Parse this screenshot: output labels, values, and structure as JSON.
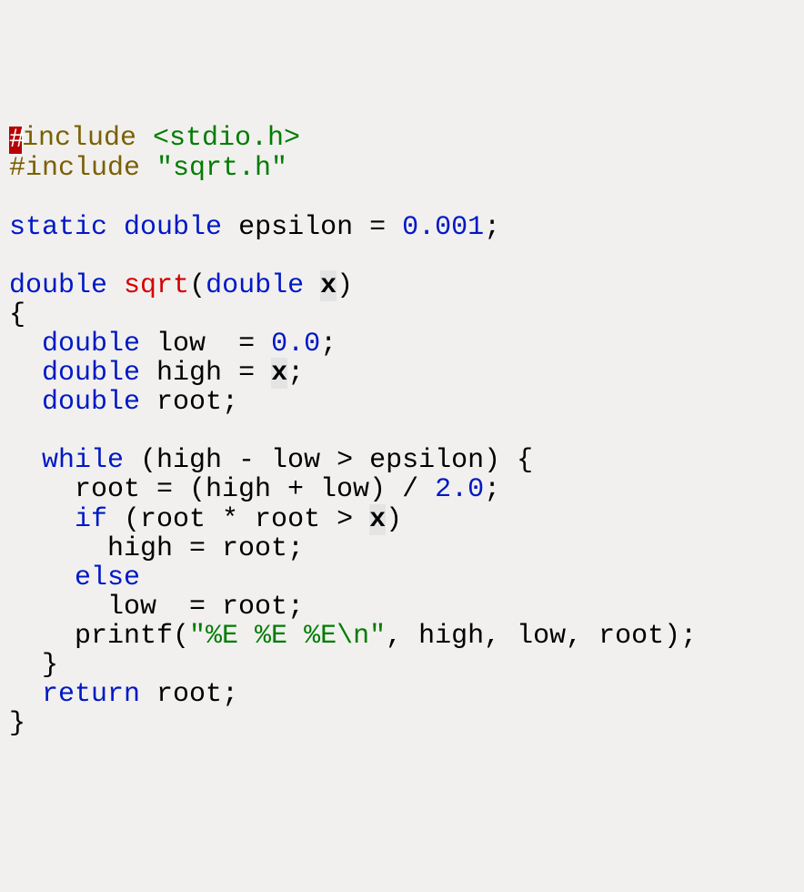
{
  "code": {
    "l1_cursor": "#",
    "l1a": "include ",
    "l1b": "<stdio.h>",
    "l2a": "#include ",
    "l2b": "\"sqrt.h\"",
    "l3": "",
    "l4a": "static",
    "l4b": " ",
    "l4c": "double",
    "l4d": " epsilon = ",
    "l4e": "0.001",
    "l4f": ";",
    "l5": "",
    "l6a": "double",
    "l6b": " ",
    "l6c": "sqrt",
    "l6d": "(",
    "l6e": "double",
    "l6f": " ",
    "l6g": "x",
    "l6h": ")",
    "l7": "{",
    "l8a": "  ",
    "l8b": "double",
    "l8c": " low  = ",
    "l8d": "0.0",
    "l8e": ";",
    "l9a": "  ",
    "l9b": "double",
    "l9c": " high = ",
    "l9d": "x",
    "l9e": ";",
    "l10a": "  ",
    "l10b": "double",
    "l10c": " root;",
    "l11": "",
    "l12a": "  ",
    "l12b": "while",
    "l12c": " (high - low > epsilon) {",
    "l13a": "    root = (high + low) / ",
    "l13b": "2.0",
    "l13c": ";",
    "l14a": "    ",
    "l14b": "if",
    "l14c": " (root * root > ",
    "l14d": "x",
    "l14e": ")",
    "l15": "      high = root;",
    "l16a": "    ",
    "l16b": "else",
    "l17": "      low  = root;",
    "l18a": "    printf(",
    "l18b": "\"%E %E %E\\n\"",
    "l18c": ", high, low, root);",
    "l19": "  }",
    "l20a": "  ",
    "l20b": "return",
    "l20c": " root;",
    "l21": "}"
  }
}
